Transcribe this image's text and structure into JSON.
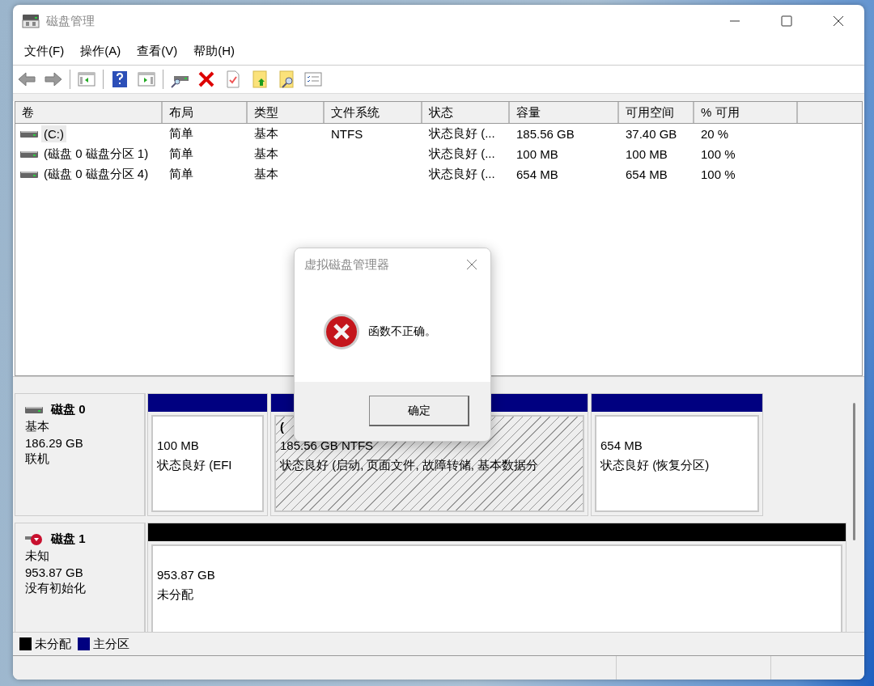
{
  "window": {
    "title": "磁盘管理"
  },
  "menu": [
    "文件(F)",
    "操作(A)",
    "查看(V)",
    "帮助(H)"
  ],
  "volumes": {
    "columns": [
      "卷",
      "布局",
      "类型",
      "文件系统",
      "状态",
      "容量",
      "可用空间",
      "% 可用"
    ],
    "rows": [
      {
        "volume": "(C:)",
        "layout": "简单",
        "type": "基本",
        "file_system": "NTFS",
        "status": "状态良好 (...",
        "capacity": "185.56 GB",
        "free_space": "37.40 GB",
        "percent_free": "20 %",
        "selected": true
      },
      {
        "volume": "(磁盘 0 磁盘分区 1)",
        "layout": "简单",
        "type": "基本",
        "status": "状态良好 (...",
        "capacity": "100 MB",
        "free_space": "100 MB",
        "percent_free": "100 %",
        "selected": false
      },
      {
        "volume": "(磁盘 0 磁盘分区 4)",
        "layout": "简单",
        "type": "基本",
        "status": "状态良好 (...",
        "capacity": "654 MB",
        "free_space": "654 MB",
        "percent_free": "100 %",
        "selected": false
      }
    ]
  },
  "disks": [
    {
      "name": "磁盘 0",
      "alert": false,
      "lines": [
        "基本",
        "186.29 GB",
        "联机"
      ],
      "partitions": [
        {
          "size": "100 MB",
          "status": "状态良好 (EFI",
          "color": "#000080",
          "selected": false
        },
        {
          "title": "(",
          "size": "185.56 GB NTFS",
          "status": "状态良好 (启动, 页面文件, 故障转储, 基本数据分",
          "color": "#000080",
          "selected": true
        },
        {
          "size": "654 MB",
          "status": "状态良好 (恢复分区)",
          "color": "#000080",
          "selected": false
        }
      ]
    },
    {
      "name": "磁盘 1",
      "alert": true,
      "lines": [
        "未知",
        "953.87 GB",
        "没有初始化"
      ],
      "partitions": [
        {
          "size": "953.87 GB",
          "status": "未分配",
          "color": "#000000",
          "selected": false
        }
      ]
    }
  ],
  "legend": [
    {
      "label": "未分配",
      "color": "#000000"
    },
    {
      "label": "主分区",
      "color": "#000080"
    }
  ],
  "dialog": {
    "title": "虚拟磁盘管理器",
    "message": "函数不正确。",
    "button": "确定"
  }
}
